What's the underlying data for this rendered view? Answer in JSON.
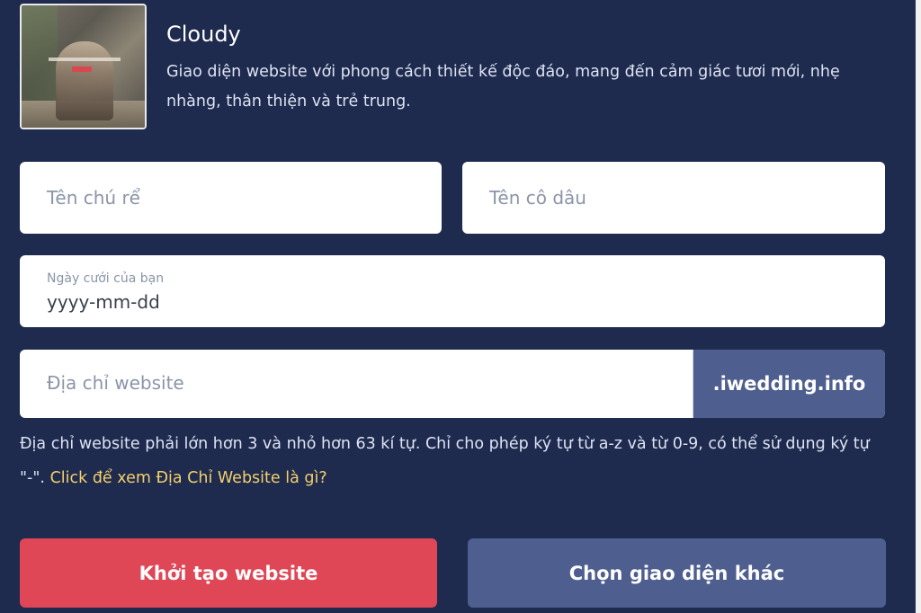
{
  "theme": {
    "name": "Cloudy",
    "description": "Giao diện website với phong cách thiết kế độc đáo, mang đến cảm giác tươi mới, nhẹ nhàng, thân thiện và trẻ trung."
  },
  "form": {
    "groom_placeholder": "Tên chú rể",
    "bride_placeholder": "Tên cô dâu",
    "date_label": "Ngày cưới của bạn",
    "date_value": "yyyy-mm-dd",
    "website_placeholder": "Địa chỉ website",
    "domain_suffix": ".iwedding.info",
    "help_text": "Địa chỉ website phải lớn hơn 3 và nhỏ hơn 63 kí tự. Chỉ cho phép ký tự từ a-z và từ 0-9, có thể sử dụng ký tự \"-\".",
    "help_link": "Click để xem Địa Chỉ Website là gì?"
  },
  "actions": {
    "create_label": "Khởi tạo website",
    "choose_label": "Chọn giao diện khác"
  },
  "colors": {
    "background": "#1e2a4e",
    "primary_button": "#df4656",
    "secondary_button": "#4e5f8f",
    "link": "#f2d06b"
  }
}
